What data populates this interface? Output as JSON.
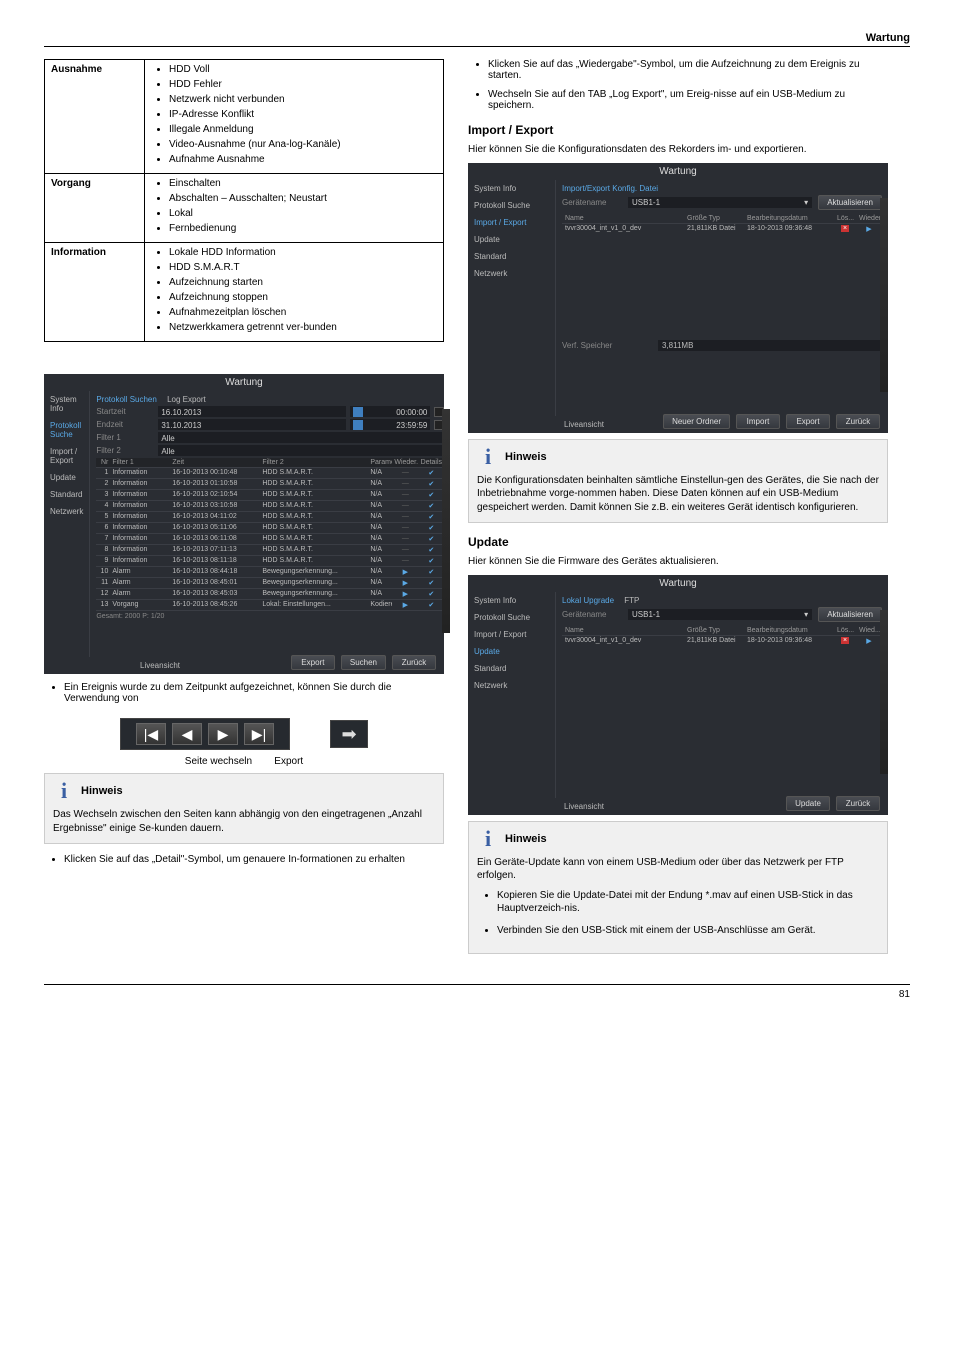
{
  "header": {
    "title": "Wartung"
  },
  "footer": {
    "left": "81",
    "right": ""
  },
  "eventsTable": {
    "rows": [
      {
        "cat": "Ausnahme",
        "items": [
          "HDD Voll",
          "HDD Fehler",
          "Netzwerk nicht verbunden",
          "IP-Adresse Konflikt",
          "Illegale Anmeldung",
          "Video-Ausnahme (nur Ana-log-Kanäle)",
          "Aufnahme Ausnahme"
        ]
      },
      {
        "cat": "Vorgang",
        "items": [
          "Einschalten",
          "Abschalten – Ausschalten; Neustart",
          "Lokal",
          "Fernbedienung"
        ]
      },
      {
        "cat": "Information",
        "items": [
          "Lokale HDD Information",
          "HDD S.M.A.R.T",
          "Aufzeichnung starten",
          "Aufzeichnung stoppen",
          "Aufnahmezeitplan löschen",
          "Netzwerkkamera getrennt ver-bunden"
        ]
      }
    ]
  },
  "shotLog": {
    "title": "Wartung",
    "sidebar": [
      "System Info",
      "Protokoll Suche",
      "Import / Export",
      "Update",
      "Standard",
      "Netzwerk"
    ],
    "activeSidebar": 1,
    "tabs": [
      "Protokoll Suchen",
      "Log Export"
    ],
    "activeTab": 0,
    "fields": {
      "startLabel": "Startzeit",
      "startDate": "16.10.2013",
      "startTime": "00:00:00",
      "endLabel": "Endzeit",
      "endDate": "31.10.2013",
      "endTime": "23:59:59",
      "filter1Label": "Filter 1",
      "filter1": "Alle",
      "filter2Label": "Filter 2",
      "filter2": "Alle"
    },
    "headers": {
      "nr": "Nr",
      "f1": "Filter 1",
      "time": "Zeit",
      "f2": "Filter 2",
      "par": "Parameter",
      "play": "Wieder...",
      "det": "Details"
    },
    "rows": [
      {
        "nr": "1",
        "f1": "Information",
        "t": "16-10-2013 00:10:48",
        "f2": "HDD S.M.A.R.T.",
        "p": "N/A",
        "w": "-",
        "d": "v"
      },
      {
        "nr": "2",
        "f1": "Information",
        "t": "16-10-2013 01:10:58",
        "f2": "HDD S.M.A.R.T.",
        "p": "N/A",
        "w": "-",
        "d": "v"
      },
      {
        "nr": "3",
        "f1": "Information",
        "t": "16-10-2013 02:10:54",
        "f2": "HDD S.M.A.R.T.",
        "p": "N/A",
        "w": "-",
        "d": "v"
      },
      {
        "nr": "4",
        "f1": "Information",
        "t": "16-10-2013 03:10:58",
        "f2": "HDD S.M.A.R.T.",
        "p": "N/A",
        "w": "-",
        "d": "v"
      },
      {
        "nr": "5",
        "f1": "Information",
        "t": "16-10-2013 04:11:02",
        "f2": "HDD S.M.A.R.T.",
        "p": "N/A",
        "w": "-",
        "d": "v"
      },
      {
        "nr": "6",
        "f1": "Information",
        "t": "16-10-2013 05:11:06",
        "f2": "HDD S.M.A.R.T.",
        "p": "N/A",
        "w": "-",
        "d": "v"
      },
      {
        "nr": "7",
        "f1": "Information",
        "t": "16-10-2013 06:11:08",
        "f2": "HDD S.M.A.R.T.",
        "p": "N/A",
        "w": "-",
        "d": "v"
      },
      {
        "nr": "8",
        "f1": "Information",
        "t": "16-10-2013 07:11:13",
        "f2": "HDD S.M.A.R.T.",
        "p": "N/A",
        "w": "-",
        "d": "v"
      },
      {
        "nr": "9",
        "f1": "Information",
        "t": "16-10-2013 08:11:18",
        "f2": "HDD S.M.A.R.T.",
        "p": "N/A",
        "w": "-",
        "d": "v"
      },
      {
        "nr": "10",
        "f1": "Alarm",
        "t": "16-10-2013 08:44:18",
        "f2": "Bewegungserkennung...",
        "p": "N/A",
        "w": "p",
        "d": "v"
      },
      {
        "nr": "11",
        "f1": "Alarm",
        "t": "16-10-2013 08:45:01",
        "f2": "Bewegungserkennung...",
        "p": "N/A",
        "w": "p",
        "d": "v"
      },
      {
        "nr": "12",
        "f1": "Alarm",
        "t": "16-10-2013 08:45:03",
        "f2": "Bewegungserkennung...",
        "p": "N/A",
        "w": "p",
        "d": "v"
      },
      {
        "nr": "13",
        "f1": "Vorgang",
        "t": "16-10-2013 08:45:26",
        "f2": "Lokal: Einstellungen...",
        "p": "Kodieren",
        "w": "p",
        "d": "v"
      }
    ],
    "summary": "Gesamt: 2000 P: 1/20",
    "footerBtns": [
      "Export",
      "Suchen",
      "Zurück"
    ],
    "liveLabel": "Liveansicht"
  },
  "leftAfterShot": {
    "bullet": "Ein Ereignis wurde zu dem Zeitpunkt aufgezeichnet, können Sie durch die Verwendung von",
    "toolbarLabel": "Seite wechseln        Export",
    "hintTitle": "Hinweis",
    "hintBody": "Das Wechseln zwischen den Seiten kann abhängig von den eingetragenen „Anzahl Ergebnisse\" einige Se-kunden dauern.",
    "detailBullet": "Klicken Sie auf das „Detail\"-Symbol, um genauere In-formationen zu erhalten"
  },
  "rightTop": {
    "b1": "Klicken Sie auf das „Wiedergabe\"-Symbol, um die Aufzeichnung zu dem Ereignis zu starten.",
    "b2": "Wechseln Sie auf den TAB „Log Export\", um Ereig-nisse auf ein USB-Medium zu speichern.",
    "secTitle": "Import / Export",
    "secPara": "Hier können Sie die Konfigurationsdaten des Rekorders im- und exportieren."
  },
  "shotImport": {
    "title": "Wartung",
    "sidebar": [
      "System Info",
      "Protokoll Suche",
      "Import / Export",
      "Update",
      "Standard",
      "Netzwerk"
    ],
    "activeSidebar": 2,
    "tabLabel": "Import/Export Konfig. Datei",
    "device": {
      "label": "Gerätename",
      "value": "USB1-1",
      "refresh": "Aktualisieren"
    },
    "headers": {
      "name": "Name",
      "size": "Größe Typ",
      "date": "Bearbeitungsdatum",
      "del": "Lös...",
      "play": "Wieder..."
    },
    "rows": [
      {
        "name": "tvvr30004_int_v1_0_dev",
        "size": "21,811KB Datei",
        "date": "18-10-2013 09:36:48"
      }
    ],
    "freeLabel": "Verf. Speicher",
    "freeVal": "3,811MB",
    "footerBtns": [
      "Neuer Ordner",
      "Import",
      "Export",
      "Zurück"
    ],
    "liveLabel": "Liveansicht"
  },
  "hintImport": {
    "title": "Hinweis",
    "body": "Die Konfigurationsdaten beinhalten sämtliche Einstellun-gen des Gerätes, die Sie nach der Inbetriebnahme vorge-nommen haben. Diese Daten können auf ein USB-Medium gespeichert werden. Damit können Sie z.B. ein weiteres Gerät identisch konfigurieren."
  },
  "rightMid": {
    "secTitle": "Update",
    "secPara": "Hier können Sie die Firmware des Gerätes aktualisieren."
  },
  "shotUpdate": {
    "title": "Wartung",
    "sidebar": [
      "System Info",
      "Protokoll Suche",
      "Import / Export",
      "Update",
      "Standard",
      "Netzwerk"
    ],
    "activeSidebar": 3,
    "tabs": [
      "Lokal Upgrade",
      "FTP"
    ],
    "activeTab": 0,
    "device": {
      "label": "Gerätename",
      "value": "USB1-1",
      "refresh": "Aktualisieren"
    },
    "headers": {
      "name": "Name",
      "size": "Größe Typ",
      "date": "Bearbeitungsdatum",
      "del": "Lös...",
      "play": "Wied..."
    },
    "rows": [
      {
        "name": "tvvr30004_int_v1_0_dev",
        "size": "21,811KB Datei",
        "date": "18-10-2013 09:36:48"
      }
    ],
    "footerBtns": [
      "Update",
      "Zurück"
    ],
    "liveLabel": "Liveansicht"
  },
  "hintUpdate": {
    "title": "Hinweis",
    "body": "Ein Geräte-Update kann von einem USB-Medium oder über das Netzwerk per FTP erfolgen.",
    "bullets": [
      "Kopieren Sie die Update-Datei mit der Endung *.mav auf einen USB-Stick in das Hauptverzeich-nis.",
      "Verbinden Sie den USB-Stick mit einem der USB-Anschlüsse am Gerät."
    ]
  }
}
